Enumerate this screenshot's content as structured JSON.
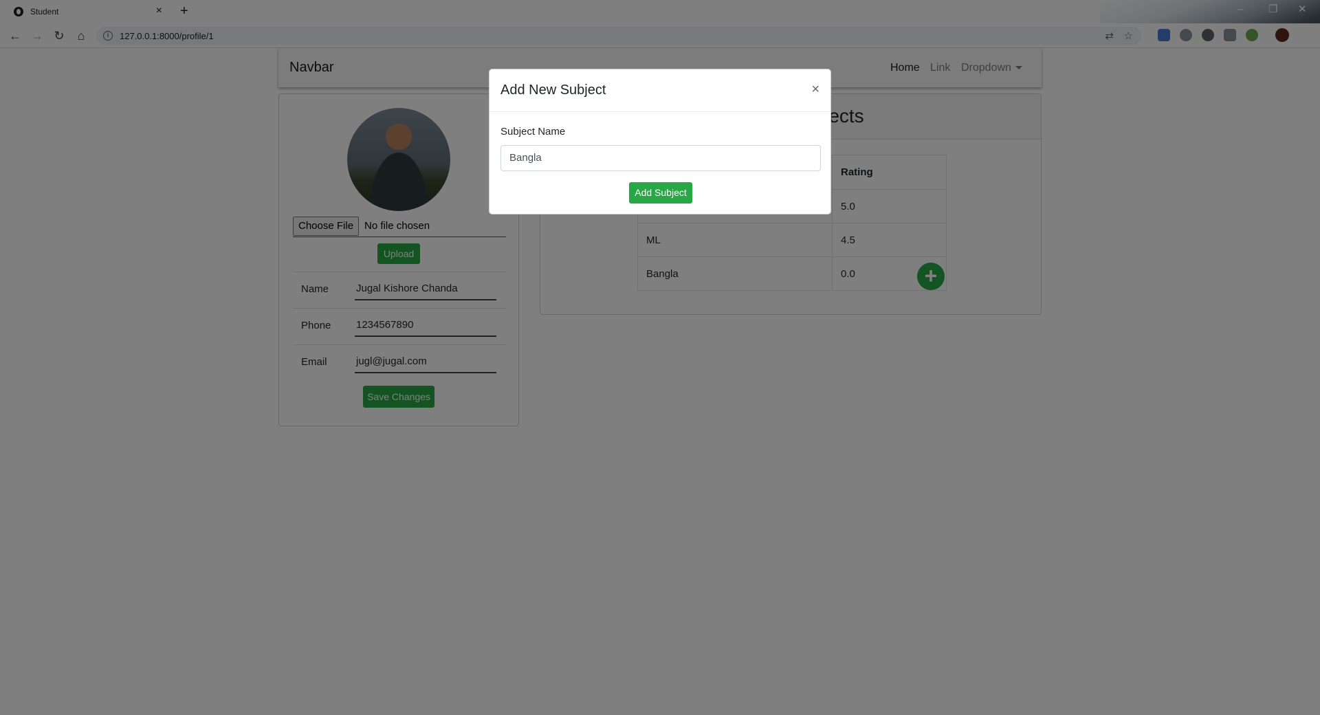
{
  "browser": {
    "tab_title": "Student",
    "tab_close": "×",
    "new_tab": "+",
    "url": "127.0.0.1:8000/profile/1",
    "icons": [
      "back-icon",
      "forward-icon",
      "reload-icon",
      "home-icon",
      "info-icon",
      "translate-icon",
      "star-icon"
    ],
    "window_controls": {
      "minimize": "–",
      "restore": "❐",
      "close": "✕"
    }
  },
  "navbar": {
    "brand": "Navbar",
    "links": [
      {
        "label": "Home"
      },
      {
        "label": "Link"
      },
      {
        "label": "Dropdown"
      }
    ]
  },
  "profile": {
    "choose_file_label": "Choose File",
    "no_file_text": "No file chosen",
    "upload_label": "Upload",
    "fields": [
      {
        "label": "Name",
        "value": "Jugal Kishore Chanda"
      },
      {
        "label": "Phone",
        "value": "1234567890"
      },
      {
        "label": "Email",
        "value": "jugl@jugal.com"
      }
    ],
    "save_label": "Save Changes"
  },
  "subjects": {
    "title_visible_fragment": "ects",
    "columns": [
      "",
      "Rating"
    ],
    "rows": [
      {
        "subject": "",
        "rating": "5.0"
      },
      {
        "subject": "ML",
        "rating": "4.5"
      },
      {
        "subject": "Bangla",
        "rating": "0.0"
      }
    ],
    "add_icon": "+"
  },
  "modal": {
    "title": "Add New Subject",
    "close": "×",
    "field_label": "Subject Name",
    "field_value": "Bangla",
    "submit_label": "Add Subject"
  },
  "colors": {
    "accent_green": "#28a745",
    "overlay": "rgba(0,0,0,0.5)"
  }
}
